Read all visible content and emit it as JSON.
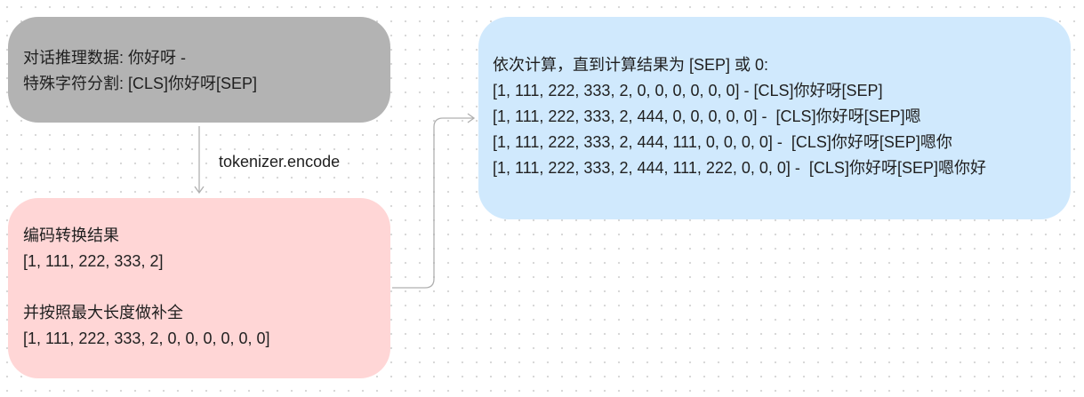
{
  "nodes": {
    "dialog": {
      "lines": [
        "对话推理数据: 你好呀 -",
        "特殊字符分割: [CLS]你好呀[SEP]"
      ]
    },
    "encode_result": {
      "lines": [
        "编码转换结果",
        "[1, 111, 222, 333, 2]",
        "",
        "并按照最大长度做补全",
        "[1, 111, 222, 333, 2, 0, 0, 0, 0, 0, 0]"
      ]
    },
    "iterative": {
      "lines": [
        "依次计算，直到计算结果为 [SEP] 或 0:",
        "[1, 111, 222, 333, 2, 0, 0, 0, 0, 0, 0] - [CLS]你好呀[SEP]",
        "[1, 111, 222, 333, 2, 444, 0, 0, 0, 0, 0] -  [CLS]你好呀[SEP]嗯",
        "[1, 111, 222, 333, 2, 444, 111, 0, 0, 0, 0] -  [CLS]你好呀[SEP]嗯你",
        "[1, 111, 222, 333, 2, 444, 111, 222, 0, 0, 0] -  [CLS]你好呀[SEP]嗯你好"
      ]
    }
  },
  "edges": {
    "encode_label": "tokenizer.encode"
  },
  "colors": {
    "dialog_fill": "#b3b3b3",
    "encode_fill": "#ffd6d6",
    "iterative_fill": "#d0e9fd",
    "connector": "#b0b0b0"
  }
}
